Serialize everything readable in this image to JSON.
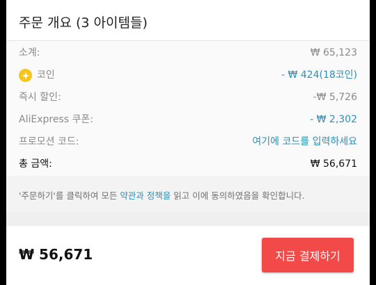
{
  "summary": {
    "title": "주문 개요 (3 아이템들)"
  },
  "rows": {
    "subtotal": {
      "label": "소계:",
      "value": "₩ 65,123"
    },
    "coins": {
      "label": "코인",
      "value": "- ₩ 424(18코인)"
    },
    "instant_discount": {
      "label": "즉시 할인:",
      "value": "-₩ 5,726"
    },
    "coupon": {
      "label": "AliExpress 쿠폰:",
      "value": "- ₩ 2,302"
    },
    "promo": {
      "label": "프로모션 코드:",
      "value": "여기에 코드를 입력하세요"
    },
    "total": {
      "label": "총 금액:",
      "value": "₩ 56,671"
    }
  },
  "notice": {
    "before": "'주문하기'를 클릭하여 모든 ",
    "link": "약관과 정책을",
    "after": " 읽고 이에 동의하였음을 확인합니다."
  },
  "footer": {
    "total": "₩ 56,671",
    "pay_button": "지금 결제하기"
  },
  "colors": {
    "accent_blue": "#2d8fb5",
    "pay_button": "#f24a48",
    "coin": "#f4c51b"
  },
  "icons": {
    "coin": "coin-icon"
  }
}
